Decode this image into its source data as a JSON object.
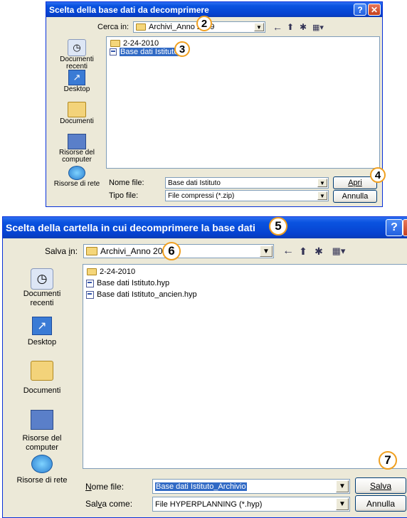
{
  "dialog1": {
    "title": "Scelta della base dati da decomprimere",
    "help_label": "?",
    "close_label": "✕",
    "look_in_label": "Cerca in:",
    "look_in_value": "Archivi_Anno 2009",
    "places": [
      "Documenti recenti",
      "Desktop",
      "Documenti",
      "Risorse del computer",
      "Risorse di rete"
    ],
    "items": [
      {
        "name": "2-24-2010",
        "kind": "folder"
      },
      {
        "name": "Base dati Istituto",
        "kind": "file",
        "selected": true
      }
    ],
    "filename_label": "Nome file:",
    "filename_value": "Base dati Istituto",
    "filetype_label": "Tipo file:",
    "filetype_value": "File compressi (*.zip)",
    "open_button": "Apri",
    "cancel_button": "Annulla"
  },
  "dialog2": {
    "title": "Scelta della cartella in cui decomprimere la base dati",
    "help_label": "?",
    "close_label": "✕",
    "save_in_label": "Salva in:",
    "save_in_value": "Archivi_Anno 200",
    "places": [
      "Documenti recenti",
      "Desktop",
      "Documenti",
      "Risorse del computer",
      "Risorse di rete"
    ],
    "items": [
      {
        "name": "2-24-2010",
        "kind": "folder"
      },
      {
        "name": "Base dati Istituto.hyp",
        "kind": "file"
      },
      {
        "name": "Base dati Istituto_ancien.hyp",
        "kind": "file"
      }
    ],
    "filename_label": "Nome file:",
    "filename_value": "Base dati Istituto_Archivio",
    "savetype_label": "Salva come:",
    "savetype_value": "File HYPERPLANNING (*.hyp)",
    "save_button": "Salva",
    "cancel_button": "Annulla"
  },
  "callouts": [
    "2",
    "3",
    "4",
    "5",
    "6",
    "7"
  ],
  "icons": {
    "back": "back-arrow-icon",
    "up": "up-folder-icon",
    "new": "new-folder-icon",
    "view": "view-menu-icon"
  },
  "colors": {
    "titlebar": "#0a53e0",
    "dialog_bg": "#ece9d8",
    "selection": "#316ac5",
    "callout_border": "#f0a020"
  }
}
